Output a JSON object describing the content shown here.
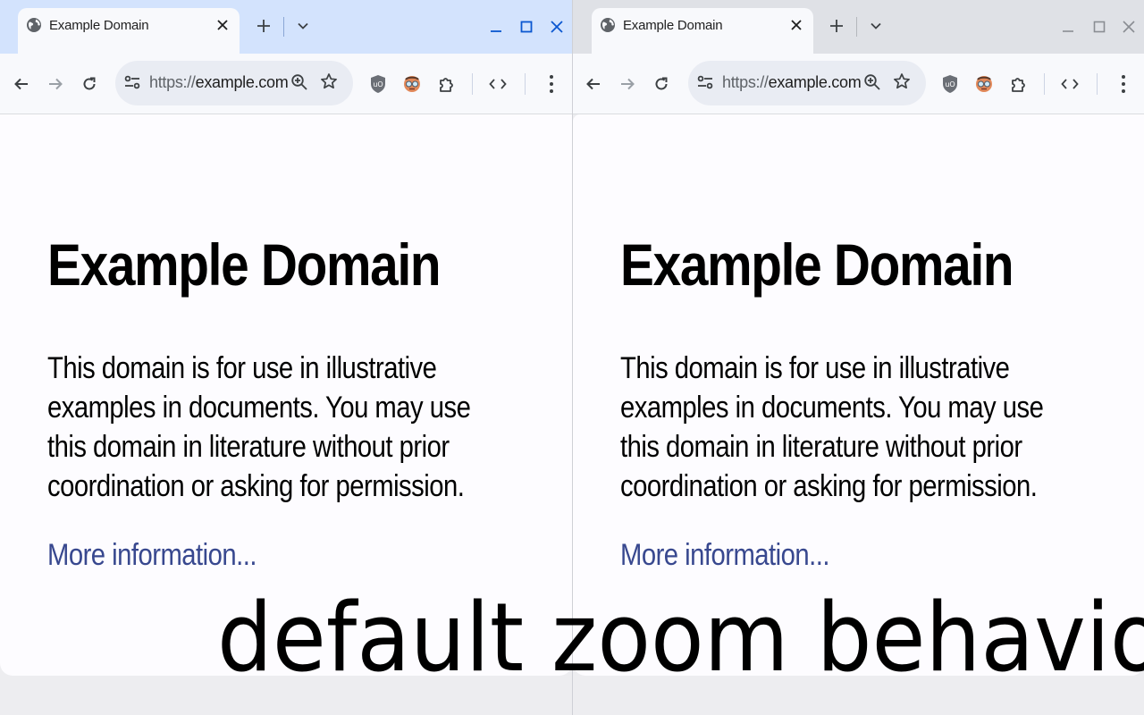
{
  "windows": [
    {
      "id": "left",
      "tab_title": "Example Domain",
      "url": {
        "scheme": "https://",
        "host": "example.com"
      },
      "page": {
        "heading": "Example Domain",
        "paragraph": "This domain is for use in illustrative examples in documents. You may use this domain in literature without prior coordination or asking for permission.",
        "link": "More information..."
      }
    },
    {
      "id": "right",
      "tab_title": "Example Domain",
      "url": {
        "scheme": "https://",
        "host": "example.com"
      },
      "page": {
        "heading": "Example Domain",
        "paragraph": "This domain is for use in illustrative examples in documents. You may use this domain in literature without prior coordination or asking for permission.",
        "link": "More information..."
      }
    }
  ],
  "icons": {
    "tab": [
      "globe-icon",
      "close-icon"
    ],
    "tabbar": [
      "new-tab-icon",
      "tab-search-icon",
      "minimize-icon",
      "maximize-icon",
      "window-close-icon"
    ],
    "toolbar": [
      "back-icon",
      "forward-icon",
      "reload-icon",
      "site-info-icon",
      "zoom-icon",
      "bookmark-star-icon",
      "ublock-icon",
      "extension-face-icon",
      "extensions-puzzle-icon",
      "devtools-icon",
      "menu-kebab-icon"
    ]
  },
  "caption": "default zoom behavior",
  "colors": {
    "active_tabbar": "#d3e3fd",
    "inactive_tabbar": "#dfe1e6",
    "link": "#38488f",
    "page_bg": "#fdfcff",
    "active_window_controls": "#0b57d0"
  }
}
